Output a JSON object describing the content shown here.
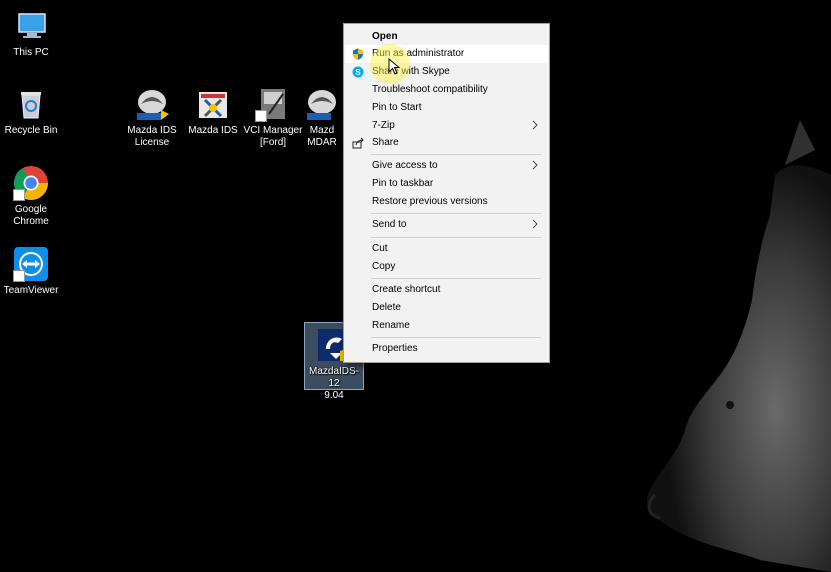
{
  "desktop": {
    "icons": [
      {
        "label": "This PC"
      },
      {
        "label": "Recycle Bin"
      },
      {
        "label": "Google\nChrome"
      },
      {
        "label": "TeamViewer"
      },
      {
        "label": "Mazda IDS\nLicense"
      },
      {
        "label": "Mazda IDS"
      },
      {
        "label": "VCI Manager\n[Ford]"
      },
      {
        "label": "Mazd\nMDAR"
      },
      {
        "label": "MazdaIDS-12\n9.04"
      }
    ]
  },
  "context_menu": {
    "items": [
      {
        "label": "Open",
        "bold": true
      },
      {
        "label": "Run as administrator",
        "icon": "shield-icon",
        "highlighted": true
      },
      {
        "label": "Share with Skype",
        "icon": "skype-icon"
      },
      {
        "label": "Troubleshoot compatibility"
      },
      {
        "label": "Pin to Start"
      },
      {
        "label": "7-Zip",
        "submenu": true
      },
      {
        "label": "Share",
        "icon": "share-icon"
      },
      {
        "label": "Give access to",
        "submenu": true
      },
      {
        "label": "Pin to taskbar"
      },
      {
        "label": "Restore previous versions"
      },
      {
        "label": "Send to",
        "submenu": true
      },
      {
        "label": "Cut"
      },
      {
        "label": "Copy"
      },
      {
        "label": "Create shortcut"
      },
      {
        "label": "Delete"
      },
      {
        "label": "Rename"
      },
      {
        "label": "Properties"
      }
    ]
  },
  "colors": {
    "desktop_bg": "#000000",
    "menu_bg": "#f2f2f2",
    "highlight": "#ffffff",
    "cursor_halo": "#fff03c",
    "shield_blue": "#1e6fd0",
    "shield_yellow": "#f0c400"
  }
}
